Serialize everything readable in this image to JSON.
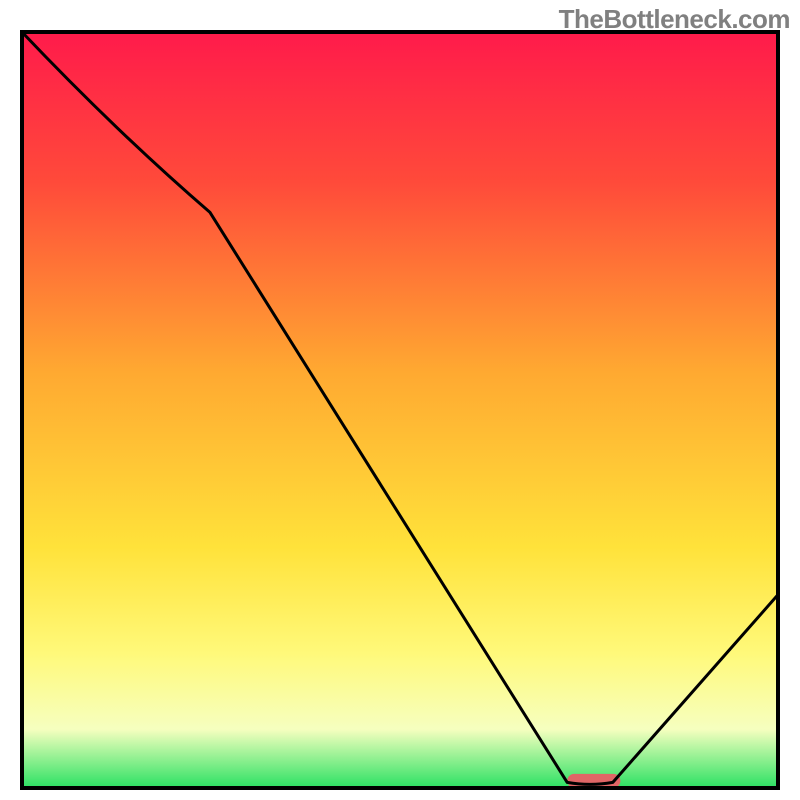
{
  "watermark": "TheBottleneck.com",
  "chart_data": {
    "type": "line",
    "title": "",
    "xlabel": "",
    "ylabel": "",
    "xlim": [
      0,
      100
    ],
    "ylim": [
      0,
      100
    ],
    "series": [
      {
        "name": "curve",
        "x": [
          0,
          25,
          72,
          78,
          100
        ],
        "y": [
          100,
          76,
          1,
          1,
          26
        ]
      }
    ],
    "marker": {
      "x_start": 72,
      "x_end": 79,
      "y": 1.2,
      "color": "#e06666"
    },
    "gradient_stops": [
      {
        "offset": 0,
        "color": "#ff1a4b"
      },
      {
        "offset": 20,
        "color": "#ff4a3a"
      },
      {
        "offset": 45,
        "color": "#ffa931"
      },
      {
        "offset": 68,
        "color": "#ffe23a"
      },
      {
        "offset": 82,
        "color": "#fff97a"
      },
      {
        "offset": 92,
        "color": "#f6ffbf"
      },
      {
        "offset": 100,
        "color": "#24e060"
      }
    ],
    "border_color": "#000000"
  }
}
